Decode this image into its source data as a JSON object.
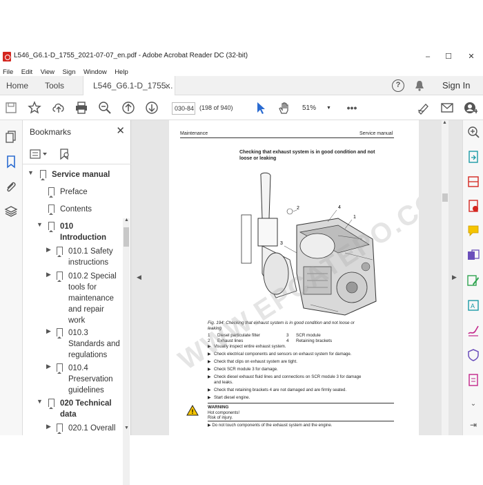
{
  "window": {
    "title": "L546_G6.1-D_1755_2021-07-07_en.pdf - Adobe Acrobat Reader DC (32-bit)",
    "min": "–",
    "max": "☐",
    "close": "✕"
  },
  "menu": [
    "File",
    "Edit",
    "View",
    "Sign",
    "Window",
    "Help"
  ],
  "tabs": {
    "home": "Home",
    "tools": "Tools",
    "doc": "L546_G6.1-D_1755...",
    "close": "×",
    "help": "?",
    "signin": "Sign In"
  },
  "toolbar": {
    "page_input": "030-84",
    "page_count": "(198 of 940)",
    "zoom": "51%"
  },
  "bookmarks": {
    "title": "Bookmarks",
    "items": [
      {
        "label": "Service manual",
        "bold": true
      },
      {
        "label": "Preface"
      },
      {
        "label": "Contents"
      },
      {
        "label": "010\nIntroduction",
        "bold": true
      },
      {
        "label": "010.1 Safety\ninstructions"
      },
      {
        "label": "010.2 Special\ntools for\nmaintenance\nand repair\nwork"
      },
      {
        "label": "010.3\nStandards and\nregulations"
      },
      {
        "label": "010.4\nPreservation\nguidelines"
      },
      {
        "label": "020 Technical\ndata",
        "bold": true
      },
      {
        "label": "020.1 Overall"
      }
    ]
  },
  "pdfpage": {
    "header_left": "Maintenance",
    "header_right": "Service manual",
    "heading": "Checking that exhaust system is in good condition and not\nloose or leaking",
    "caption": "Fig. 194: Checking that exhaust system is in good condition and not loose or\nleaking",
    "legend": [
      {
        "n": "1",
        "t": "Diesel particulate filter"
      },
      {
        "n": "2",
        "t": "Exhaust lines"
      },
      {
        "n": "3",
        "t": "SCR module"
      },
      {
        "n": "4",
        "t": "Retaining brackets"
      }
    ],
    "steps": [
      "Visually inspect entire exhaust system.",
      "Check electrical components and sensors on exhaust system for damage.",
      "Check that clips on exhaust system are tight.",
      "Check SCR module 3 for damage.",
      "Check diesel exhaust fluid lines and connections on SCR module 3 for damage\nand leaks.",
      "Check that retaining brackets 4 are not damaged and are firmly seated.",
      "Start diesel engine."
    ],
    "warning_title": "WARNING",
    "warning_lines": [
      "Hot components!",
      "Risk of injury."
    ],
    "warning_step": "Do not touch components of the exhaust system and the engine.",
    "watermark": "WWW.EPCATEPO.COM",
    "fig_nums": [
      "1",
      "2",
      "3",
      "4"
    ]
  }
}
